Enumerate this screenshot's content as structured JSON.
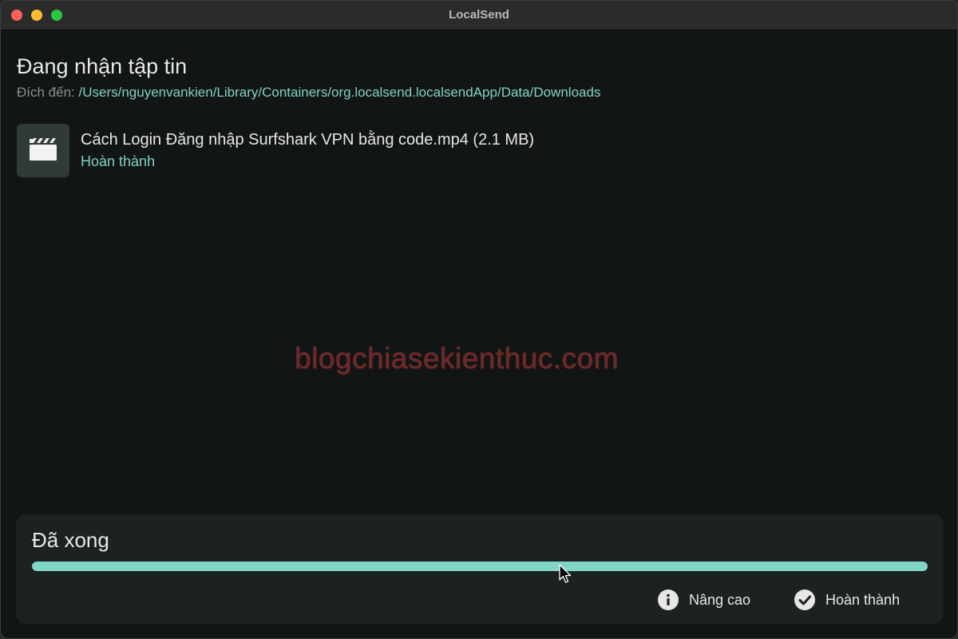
{
  "window": {
    "title": "LocalSend"
  },
  "receive": {
    "heading": "Đang nhận tập tin",
    "destination_label": "Đích đến:",
    "destination_path": "/Users/nguyenvankien/Library/Containers/org.localsend.localsendApp/Data/Downloads"
  },
  "files": [
    {
      "icon": "video-clapperboard-icon",
      "name": "Cách Login Đăng nhập Surfshark VPN bằng code.mp4 (2.1 MB)",
      "status": "Hoàn thành"
    }
  ],
  "watermark": "blogchiasekienthuc.com",
  "progress": {
    "title": "Đã xong",
    "fraction": 1.0,
    "color": "#82d6c4"
  },
  "actions": {
    "advanced_label": "Nâng cao",
    "advanced_icon": "info-icon",
    "done_label": "Hoàn thành",
    "done_icon": "check-circle-icon"
  },
  "colors": {
    "accent": "#7fd3c3",
    "background": "#121515",
    "panel": "#1c2121"
  }
}
